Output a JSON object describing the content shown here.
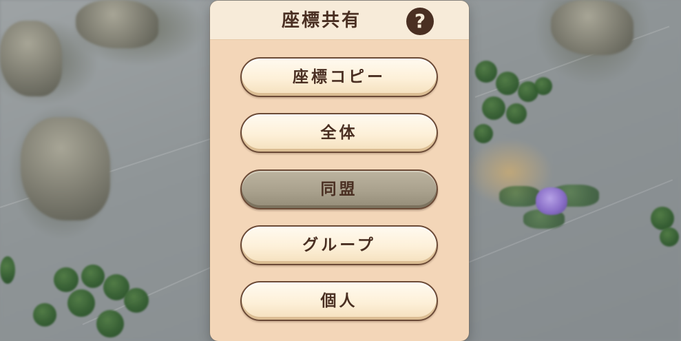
{
  "dialog": {
    "title": "座標共有",
    "help_icon": "question-mark-icon",
    "help_symbol": "?"
  },
  "options": [
    {
      "label": "座標コピー",
      "selected": false
    },
    {
      "label": "全体",
      "selected": false
    },
    {
      "label": "同盟",
      "selected": true
    },
    {
      "label": "グループ",
      "selected": false
    },
    {
      "label": "個人",
      "selected": false
    }
  ],
  "colors": {
    "panel_background": "#f3d6b8",
    "header_background": "#f7ebd9",
    "text_dark_brown": "#4a2f22",
    "button_cream": "#fdf0d8",
    "button_selected_gray": "#a9a18d"
  }
}
